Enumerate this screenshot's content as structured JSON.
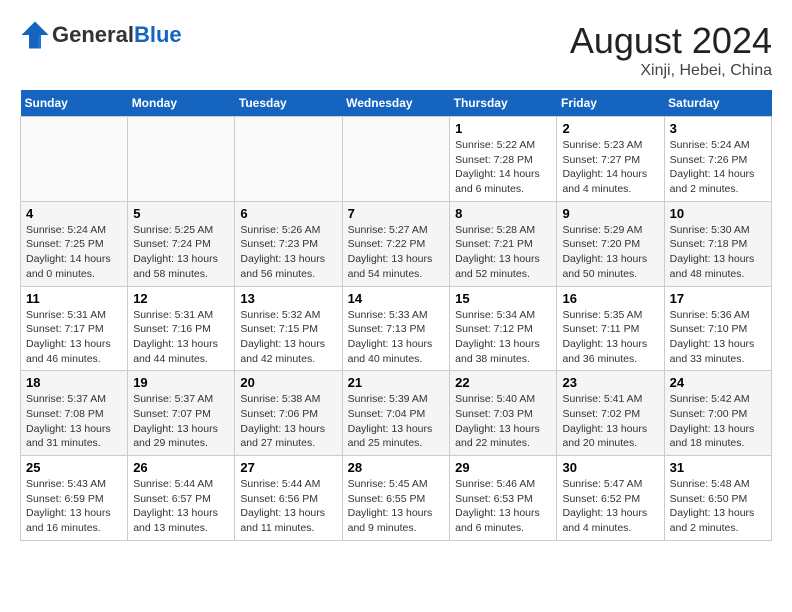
{
  "header": {
    "logo_general": "General",
    "logo_blue": "Blue",
    "month_title": "August 2024",
    "location": "Xinji, Hebei, China"
  },
  "days_of_week": [
    "Sunday",
    "Monday",
    "Tuesday",
    "Wednesday",
    "Thursday",
    "Friday",
    "Saturday"
  ],
  "weeks": [
    [
      {
        "num": "",
        "info": ""
      },
      {
        "num": "",
        "info": ""
      },
      {
        "num": "",
        "info": ""
      },
      {
        "num": "",
        "info": ""
      },
      {
        "num": "1",
        "info": "Sunrise: 5:22 AM\nSunset: 7:28 PM\nDaylight: 14 hours\nand 6 minutes."
      },
      {
        "num": "2",
        "info": "Sunrise: 5:23 AM\nSunset: 7:27 PM\nDaylight: 14 hours\nand 4 minutes."
      },
      {
        "num": "3",
        "info": "Sunrise: 5:24 AM\nSunset: 7:26 PM\nDaylight: 14 hours\nand 2 minutes."
      }
    ],
    [
      {
        "num": "4",
        "info": "Sunrise: 5:24 AM\nSunset: 7:25 PM\nDaylight: 14 hours\nand 0 minutes."
      },
      {
        "num": "5",
        "info": "Sunrise: 5:25 AM\nSunset: 7:24 PM\nDaylight: 13 hours\nand 58 minutes."
      },
      {
        "num": "6",
        "info": "Sunrise: 5:26 AM\nSunset: 7:23 PM\nDaylight: 13 hours\nand 56 minutes."
      },
      {
        "num": "7",
        "info": "Sunrise: 5:27 AM\nSunset: 7:22 PM\nDaylight: 13 hours\nand 54 minutes."
      },
      {
        "num": "8",
        "info": "Sunrise: 5:28 AM\nSunset: 7:21 PM\nDaylight: 13 hours\nand 52 minutes."
      },
      {
        "num": "9",
        "info": "Sunrise: 5:29 AM\nSunset: 7:20 PM\nDaylight: 13 hours\nand 50 minutes."
      },
      {
        "num": "10",
        "info": "Sunrise: 5:30 AM\nSunset: 7:18 PM\nDaylight: 13 hours\nand 48 minutes."
      }
    ],
    [
      {
        "num": "11",
        "info": "Sunrise: 5:31 AM\nSunset: 7:17 PM\nDaylight: 13 hours\nand 46 minutes."
      },
      {
        "num": "12",
        "info": "Sunrise: 5:31 AM\nSunset: 7:16 PM\nDaylight: 13 hours\nand 44 minutes."
      },
      {
        "num": "13",
        "info": "Sunrise: 5:32 AM\nSunset: 7:15 PM\nDaylight: 13 hours\nand 42 minutes."
      },
      {
        "num": "14",
        "info": "Sunrise: 5:33 AM\nSunset: 7:13 PM\nDaylight: 13 hours\nand 40 minutes."
      },
      {
        "num": "15",
        "info": "Sunrise: 5:34 AM\nSunset: 7:12 PM\nDaylight: 13 hours\nand 38 minutes."
      },
      {
        "num": "16",
        "info": "Sunrise: 5:35 AM\nSunset: 7:11 PM\nDaylight: 13 hours\nand 36 minutes."
      },
      {
        "num": "17",
        "info": "Sunrise: 5:36 AM\nSunset: 7:10 PM\nDaylight: 13 hours\nand 33 minutes."
      }
    ],
    [
      {
        "num": "18",
        "info": "Sunrise: 5:37 AM\nSunset: 7:08 PM\nDaylight: 13 hours\nand 31 minutes."
      },
      {
        "num": "19",
        "info": "Sunrise: 5:37 AM\nSunset: 7:07 PM\nDaylight: 13 hours\nand 29 minutes."
      },
      {
        "num": "20",
        "info": "Sunrise: 5:38 AM\nSunset: 7:06 PM\nDaylight: 13 hours\nand 27 minutes."
      },
      {
        "num": "21",
        "info": "Sunrise: 5:39 AM\nSunset: 7:04 PM\nDaylight: 13 hours\nand 25 minutes."
      },
      {
        "num": "22",
        "info": "Sunrise: 5:40 AM\nSunset: 7:03 PM\nDaylight: 13 hours\nand 22 minutes."
      },
      {
        "num": "23",
        "info": "Sunrise: 5:41 AM\nSunset: 7:02 PM\nDaylight: 13 hours\nand 20 minutes."
      },
      {
        "num": "24",
        "info": "Sunrise: 5:42 AM\nSunset: 7:00 PM\nDaylight: 13 hours\nand 18 minutes."
      }
    ],
    [
      {
        "num": "25",
        "info": "Sunrise: 5:43 AM\nSunset: 6:59 PM\nDaylight: 13 hours\nand 16 minutes."
      },
      {
        "num": "26",
        "info": "Sunrise: 5:44 AM\nSunset: 6:57 PM\nDaylight: 13 hours\nand 13 minutes."
      },
      {
        "num": "27",
        "info": "Sunrise: 5:44 AM\nSunset: 6:56 PM\nDaylight: 13 hours\nand 11 minutes."
      },
      {
        "num": "28",
        "info": "Sunrise: 5:45 AM\nSunset: 6:55 PM\nDaylight: 13 hours\nand 9 minutes."
      },
      {
        "num": "29",
        "info": "Sunrise: 5:46 AM\nSunset: 6:53 PM\nDaylight: 13 hours\nand 6 minutes."
      },
      {
        "num": "30",
        "info": "Sunrise: 5:47 AM\nSunset: 6:52 PM\nDaylight: 13 hours\nand 4 minutes."
      },
      {
        "num": "31",
        "info": "Sunrise: 5:48 AM\nSunset: 6:50 PM\nDaylight: 13 hours\nand 2 minutes."
      }
    ]
  ]
}
